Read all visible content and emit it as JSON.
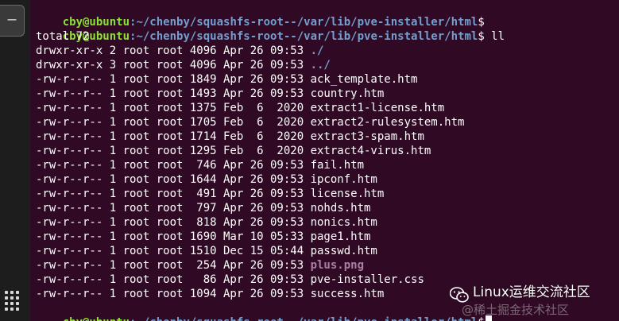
{
  "dock": {
    "button_label": "–"
  },
  "terminal": {
    "prompt_user": "cby@ubuntu",
    "prompt_path": ":~/chenby/squashfs-root--/var/lib/pve-installer/html",
    "prompt_symbol": "$",
    "command": " ll",
    "total": "total 72",
    "entries": [
      {
        "meta": "drwxr-xr-x 2 root root 4096 Apr 26 09:53 ",
        "name": "./",
        "kind": "dir"
      },
      {
        "meta": "drwxr-xr-x 3 root root 4096 Apr 26 09:53 ",
        "name": "../",
        "kind": "dir"
      },
      {
        "meta": "-rw-r--r-- 1 root root 1849 Apr 26 09:53 ",
        "name": "ack_template.htm",
        "kind": "file"
      },
      {
        "meta": "-rw-r--r-- 1 root root 1493 Apr 26 09:53 ",
        "name": "country.htm",
        "kind": "file"
      },
      {
        "meta": "-rw-r--r-- 1 root root 1375 Feb  6  2020 ",
        "name": "extract1-license.htm",
        "kind": "file"
      },
      {
        "meta": "-rw-r--r-- 1 root root 1705 Feb  6  2020 ",
        "name": "extract2-rulesystem.htm",
        "kind": "file"
      },
      {
        "meta": "-rw-r--r-- 1 root root 1714 Feb  6  2020 ",
        "name": "extract3-spam.htm",
        "kind": "file"
      },
      {
        "meta": "-rw-r--r-- 1 root root 1295 Feb  6  2020 ",
        "name": "extract4-virus.htm",
        "kind": "file"
      },
      {
        "meta": "-rw-r--r-- 1 root root  746 Apr 26 09:53 ",
        "name": "fail.htm",
        "kind": "file"
      },
      {
        "meta": "-rw-r--r-- 1 root root 1644 Apr 26 09:53 ",
        "name": "ipconf.htm",
        "kind": "file"
      },
      {
        "meta": "-rw-r--r-- 1 root root  491 Apr 26 09:53 ",
        "name": "license.htm",
        "kind": "file"
      },
      {
        "meta": "-rw-r--r-- 1 root root  797 Apr 26 09:53 ",
        "name": "nohds.htm",
        "kind": "file"
      },
      {
        "meta": "-rw-r--r-- 1 root root  818 Apr 26 09:53 ",
        "name": "nonics.htm",
        "kind": "file"
      },
      {
        "meta": "-rw-r--r-- 1 root root 1690 Mar 10 05:33 ",
        "name": "page1.htm",
        "kind": "file"
      },
      {
        "meta": "-rw-r--r-- 1 root root 1510 Dec 15 05:44 ",
        "name": "passwd.htm",
        "kind": "file"
      },
      {
        "meta": "-rw-r--r-- 1 root root  254 Apr 26 09:53 ",
        "name": "plus.png",
        "kind": "image"
      },
      {
        "meta": "-rw-r--r-- 1 root root   86 Apr 26 09:53 ",
        "name": "pve-installer.css",
        "kind": "file"
      },
      {
        "meta": "-rw-r--r-- 1 root root 1094 Apr 26 09:53 ",
        "name": "success.htm",
        "kind": "file"
      }
    ]
  },
  "watermark": {
    "title": "Linux运维交流社区",
    "subtitle": "@稀土掘金技术社区"
  },
  "colors": {
    "background": "#300a24",
    "prompt_user": "#8ae234",
    "prompt_path": "#729fcf",
    "directory": "#729fcf",
    "image_file": "#ad7fa8",
    "text": "#ffffff"
  }
}
